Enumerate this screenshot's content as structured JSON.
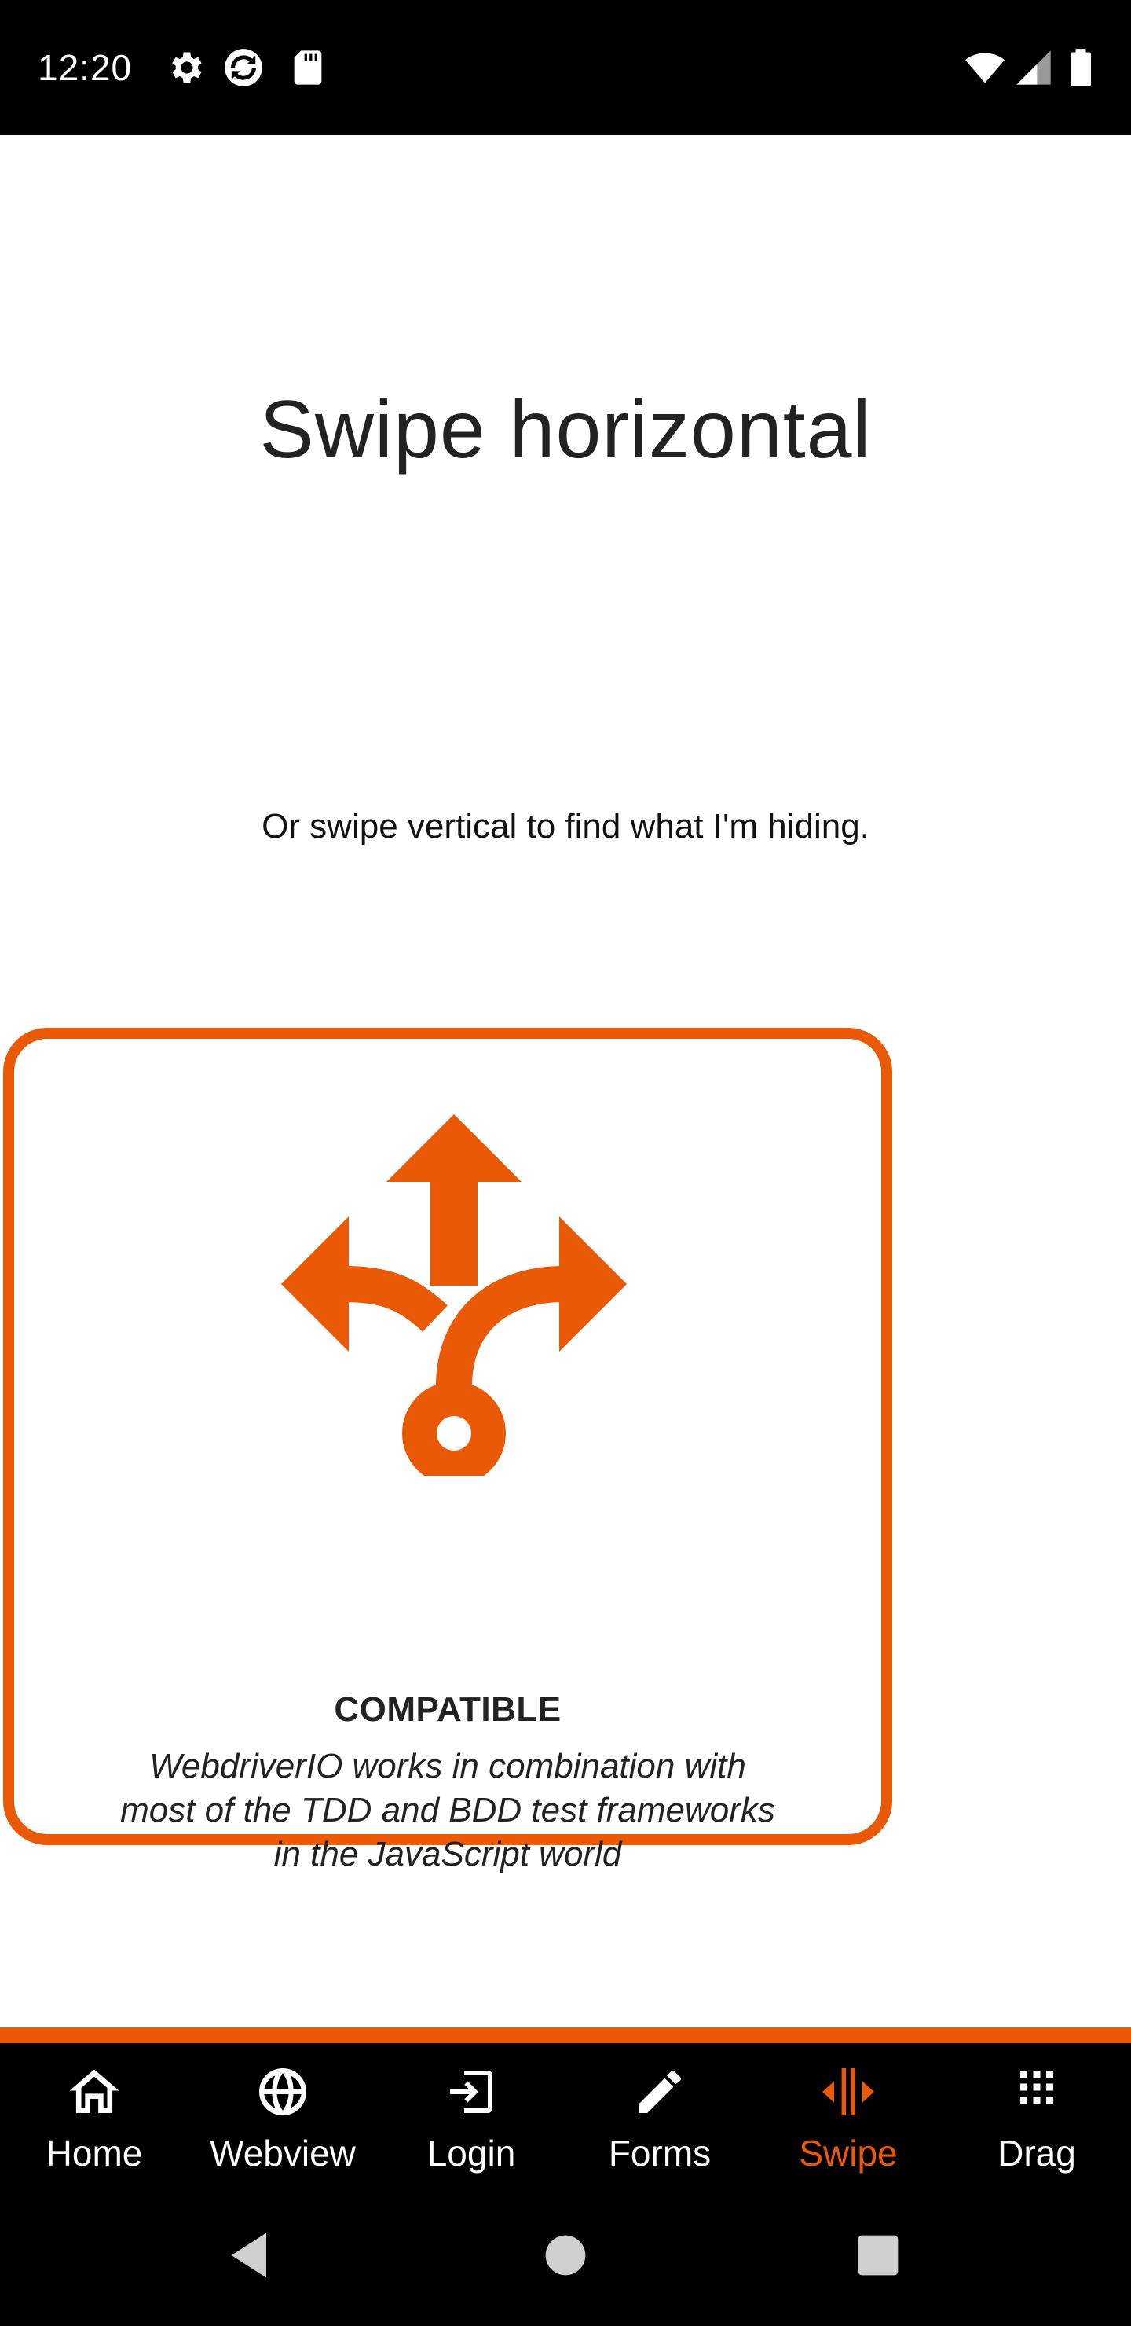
{
  "status_bar": {
    "time": "12:20",
    "icons": [
      "gear-icon",
      "sync-icon",
      "sd-card-icon",
      "wifi-icon",
      "cell-signal-icon",
      "battery-icon"
    ]
  },
  "screen": {
    "title": "Swipe horizontal",
    "subtitle": "Or swipe vertical to find what I'm hiding."
  },
  "card": {
    "icon": "split-arrows-icon",
    "title": "COMPATIBLE",
    "text_lines": [
      "WebdriverIO works in combination with",
      "most of the TDD and BDD test frameworks",
      "in the JavaScript world"
    ]
  },
  "bottom_nav": {
    "items": [
      {
        "label": "Home",
        "icon": "home-icon",
        "active": false
      },
      {
        "label": "Webview",
        "icon": "globe-icon",
        "active": false
      },
      {
        "label": "Login",
        "icon": "login-icon",
        "active": false
      },
      {
        "label": "Forms",
        "icon": "pencil-icon",
        "active": false
      },
      {
        "label": "Swipe",
        "icon": "swipe-icon",
        "active": true
      },
      {
        "label": "Drag",
        "icon": "grid-dots-icon",
        "active": false
      }
    ]
  },
  "system_nav": {
    "buttons": [
      "back-icon",
      "home-circle-icon",
      "recents-icon"
    ]
  },
  "colors": {
    "accent": "#ea5906",
    "bars": "#000000",
    "text": "#222222",
    "background": "#ffffff"
  }
}
